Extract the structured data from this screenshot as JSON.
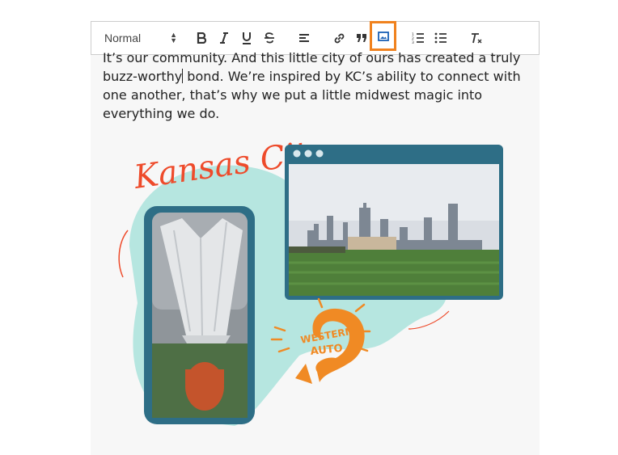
{
  "toolbar": {
    "format_value": "Normal",
    "buttons": [
      {
        "name": "bold",
        "icon": "bold-icon"
      },
      {
        "name": "italic",
        "icon": "italic-icon"
      },
      {
        "name": "underline",
        "icon": "underline-icon"
      },
      {
        "name": "strike",
        "icon": "strikethrough-icon"
      },
      {
        "name": "align",
        "icon": "align-left-icon"
      },
      {
        "name": "link",
        "icon": "link-icon"
      },
      {
        "name": "blockquote",
        "icon": "quote-icon"
      },
      {
        "name": "image",
        "icon": "image-icon",
        "highlighted": true
      },
      {
        "name": "ordered-list",
        "icon": "ordered-list-icon"
      },
      {
        "name": "bullet-list",
        "icon": "bullet-list-icon"
      },
      {
        "name": "clear-format",
        "icon": "clear-format-icon"
      }
    ],
    "highlight_color": "#f0821e"
  },
  "editor": {
    "line1": "It’s our community. And this little city of ours has created a truly",
    "line2_before_caret": "buzz-worthy",
    "line2_after_caret": " bond. We’re inspired by KC’s ability to connect with",
    "line3": "one another, that’s why we put a little midwest magic into",
    "line4": "everything we do."
  },
  "illustration": {
    "script_title": "Kansas City",
    "badge_line1": "WESTERN",
    "badge_line2": "AUTO",
    "colors": {
      "teal": "#b6e6e0",
      "frame": "#2e6e86",
      "accent": "#ee4b2b",
      "orange": "#f08a24"
    }
  }
}
